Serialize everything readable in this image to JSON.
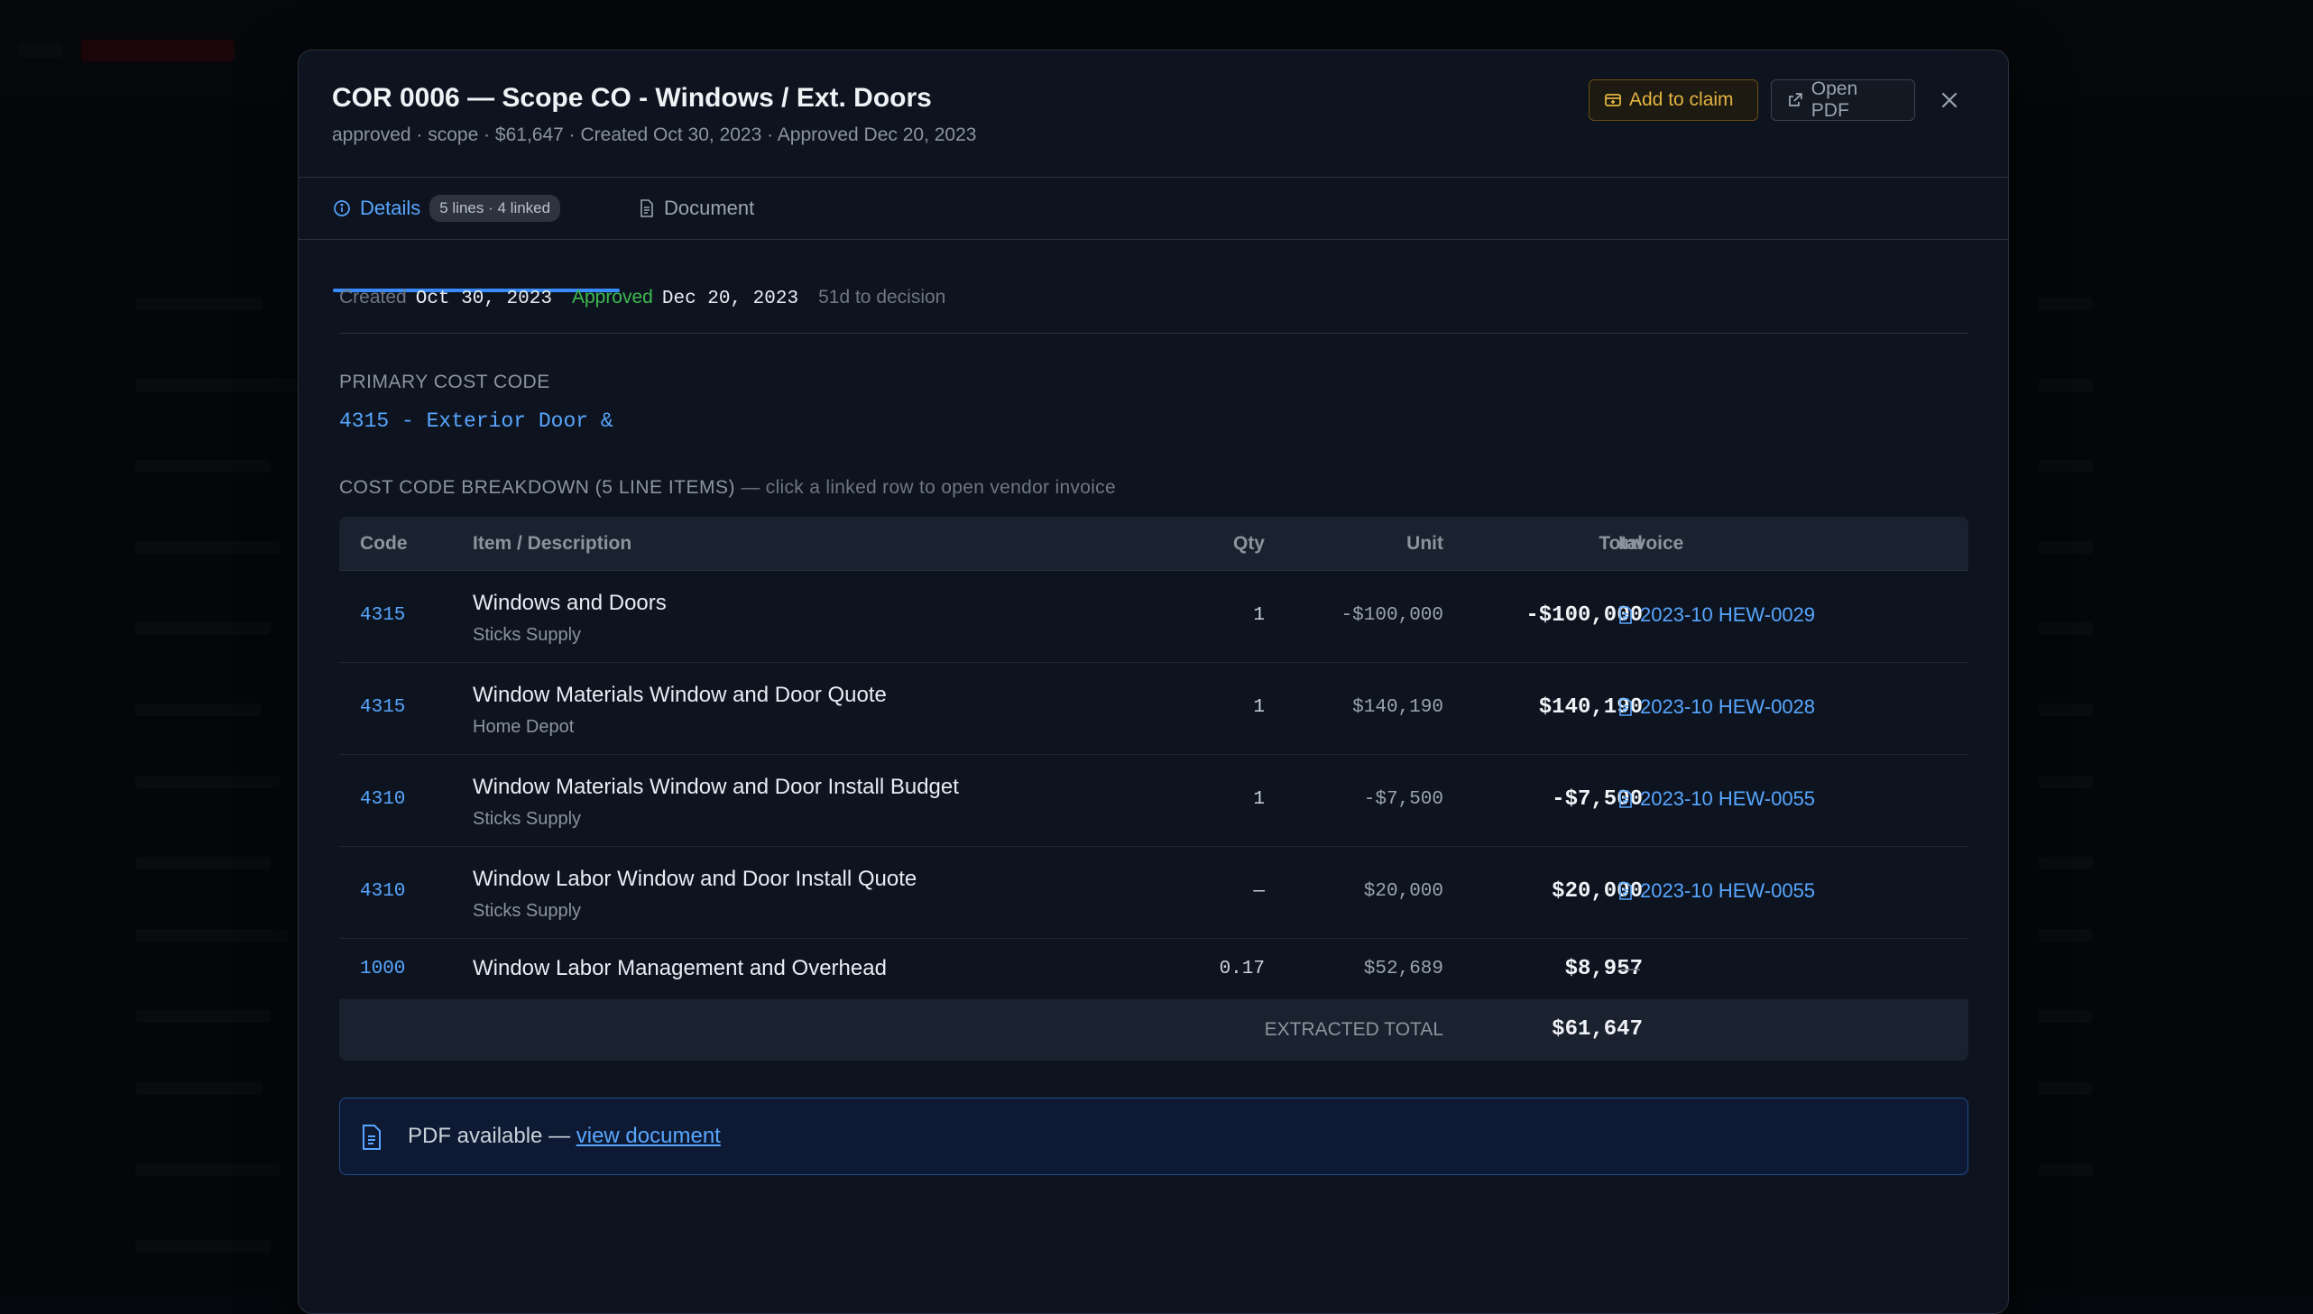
{
  "modal": {
    "title": "COR 0006 — Scope CO - Windows / Ext. Doors",
    "subtitle": "approved · scope · $61,647 · Created Oct 30, 2023 · Approved Dec 20, 2023",
    "add_to_claim_label": "Add to claim",
    "open_pdf_label": "Open PDF"
  },
  "tabs": {
    "details_label": "Details",
    "details_badge": "5 lines · 4 linked",
    "document_label": "Document"
  },
  "dates": {
    "created_label": "Created",
    "created_value": "Oct 30, 2023",
    "approved_label": "Approved",
    "approved_value": "Dec 20, 2023",
    "decision_text": "51d to decision"
  },
  "primary_cost_code": {
    "label": "PRIMARY COST CODE",
    "value": "4315 - Exterior Door &"
  },
  "breakdown": {
    "label": "COST CODE BREAKDOWN (5 LINE ITEMS)",
    "hint": "— click a linked row to open vendor invoice",
    "headers": {
      "code": "Code",
      "item": "Item / Description",
      "qty": "Qty",
      "unit": "Unit",
      "total": "Total",
      "invoice": "Invoice"
    },
    "rows": [
      {
        "code": "4315",
        "item": "Windows and Doors",
        "vendor": "Sticks Supply",
        "qty": "1",
        "unit": "-$100,000",
        "total": "-$100,000",
        "invoice": "2023-10 HEW-0029"
      },
      {
        "code": "4315",
        "item": "Window Materials Window and Door Quote",
        "vendor": "Home Depot",
        "qty": "1",
        "unit": "$140,190",
        "total": "$140,190",
        "invoice": "2023-10 HEW-0028"
      },
      {
        "code": "4310",
        "item": "Window Materials Window and Door Install Budget",
        "vendor": "Sticks Supply",
        "qty": "1",
        "unit": "-$7,500",
        "total": "-$7,500",
        "invoice": "2023-10 HEW-0055"
      },
      {
        "code": "4310",
        "item": "Window Labor Window and Door Install Quote",
        "vendor": "Sticks Supply",
        "qty": "—",
        "unit": "$20,000",
        "total": "$20,000",
        "invoice": "2023-10 HEW-0055"
      },
      {
        "code": "1000",
        "item": "Window Labor Management and Overhead",
        "vendor": "",
        "qty": "0.17",
        "unit": "$52,689",
        "total": "$8,957",
        "invoice": "—"
      }
    ],
    "footer_label": "EXTRACTED TOTAL",
    "footer_total": "$61,647"
  },
  "pdf_banner": {
    "text": "PDF available —",
    "link": "view document"
  },
  "icons": {
    "claim": "claim-icon",
    "external": "external-link-icon",
    "close": "close-icon",
    "info": "info-icon",
    "document": "document-icon",
    "invoice": "invoice-icon"
  },
  "colors": {
    "accent": "#58a6ff",
    "approved": "#3fb950",
    "claim": "#e3b341"
  }
}
